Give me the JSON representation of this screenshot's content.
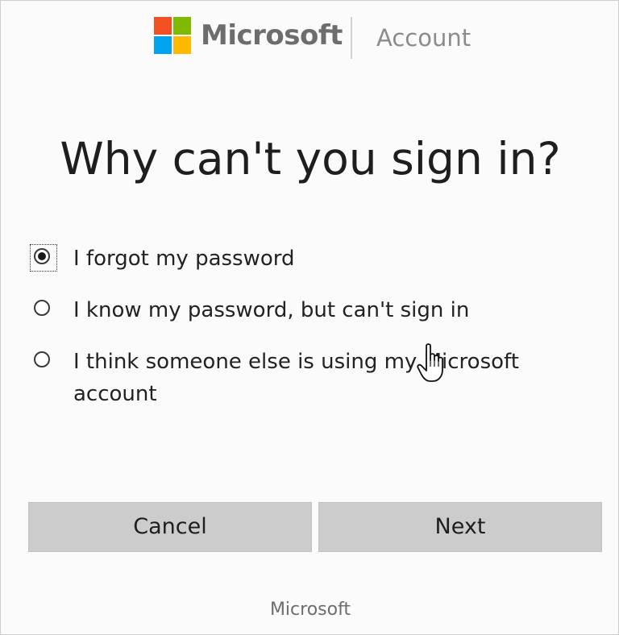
{
  "header": {
    "brand": "Microsoft",
    "section": "Account",
    "logo_colors": [
      "#f25022",
      "#7fba00",
      "#00a4ef",
      "#ffb900"
    ]
  },
  "title": "Why can't you sign in?",
  "options": [
    {
      "label": "I forgot my password",
      "selected": true
    },
    {
      "label": "I know my password, but can't sign in",
      "selected": false
    },
    {
      "label": "I think someone else is using my Microsoft account",
      "selected": false
    }
  ],
  "buttons": {
    "cancel": "Cancel",
    "next": "Next"
  },
  "footer": "Microsoft",
  "cursor_icon": "hand-pointer-icon"
}
